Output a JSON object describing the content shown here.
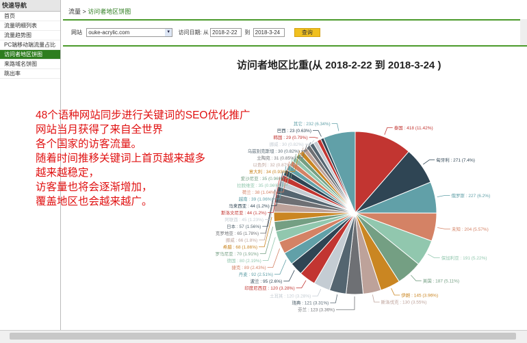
{
  "sidebar": {
    "title": "快速导航",
    "items": [
      "首页",
      "流量明细列表",
      "流量趋势图",
      "PC端移动端流量占比",
      "访问者地区饼图",
      "来路域名饼图",
      "跳出率"
    ],
    "active": 4
  },
  "breadcrumb": {
    "root": "流量",
    "sep": " > ",
    "current": "访问者地区饼图"
  },
  "filter": {
    "site_label": "网站",
    "site_value": "ouke-acrylic.com",
    "date_label": "访问日期: 从",
    "date_from": "2018-2-22",
    "to_label": "到",
    "date_to": "2018-3-24",
    "query_label": "查询"
  },
  "overlay_lines": [
    "48个语种网站同步进行关键词的SEO优化推广",
    "网站当月获得了来自全世界",
    "各个国家的访客流量。",
    "随着时间推移关键词上首页越来越多",
    "越来越稳定，",
    "访客量也将会逐渐增加，",
    "覆盖地区也会越来越广。"
  ],
  "chart_data": {
    "type": "pie",
    "title": "访问者地区比重(从 2018-2-22 到 2018-3-24 )",
    "slices": [
      {
        "label": "泰国",
        "value": 418,
        "pct": "11.42%",
        "color": "#c23531"
      },
      {
        "label": "匈牙利",
        "value": 271,
        "pct": "7.4%",
        "color": "#2f4554"
      },
      {
        "label": "俄罗斯",
        "value": 227,
        "pct": "6.2%",
        "color": "#61a0a8"
      },
      {
        "label": "未知",
        "value": 204,
        "pct": "5.57%",
        "color": "#d48265"
      },
      {
        "label": "保加利亚",
        "value": 191,
        "pct": "5.22%",
        "color": "#91c7ae"
      },
      {
        "label": "美国",
        "value": 187,
        "pct": "5.11%",
        "color": "#749f83"
      },
      {
        "label": "伊朗",
        "value": 145,
        "pct": "3.96%",
        "color": "#ca8622"
      },
      {
        "label": "斯洛伐克",
        "value": 130,
        "pct": "3.55%",
        "color": "#bda29a"
      },
      {
        "label": "芬兰",
        "value": 123,
        "pct": "3.36%",
        "color": "#6e7074"
      },
      {
        "label": "瑞典",
        "value": 121,
        "pct": "3.31%",
        "color": "#546570"
      },
      {
        "label": "土耳其",
        "value": 120,
        "pct": "3.28%",
        "color": "#c4ccd3"
      },
      {
        "label": "印度尼西亚",
        "value": 120,
        "pct": "3.28%",
        "color": "#c23531"
      },
      {
        "label": "波兰",
        "value": 95,
        "pct": "2.6%",
        "color": "#2f4554"
      },
      {
        "label": "丹麦",
        "value": 92,
        "pct": "2.51%",
        "color": "#61a0a8"
      },
      {
        "label": "捷克",
        "value": 89,
        "pct": "2.43%",
        "color": "#d48265"
      },
      {
        "label": "德国",
        "value": 80,
        "pct": "2.19%",
        "color": "#91c7ae"
      },
      {
        "label": "罗马尼亚",
        "value": 70,
        "pct": "1.91%",
        "color": "#749f83"
      },
      {
        "label": "希腊",
        "value": 68,
        "pct": "1.86%",
        "color": "#ca8622"
      },
      {
        "label": "挪威",
        "value": 66,
        "pct": "1.8%",
        "color": "#bda29a"
      },
      {
        "label": "克罗地亚",
        "value": 65,
        "pct": "1.78%",
        "color": "#6e7074"
      },
      {
        "label": "日本",
        "value": 57,
        "pct": "1.56%",
        "color": "#546570"
      },
      {
        "label": "阿联酋",
        "value": 45,
        "pct": "1.23%",
        "color": "#c4ccd3"
      },
      {
        "label": "斯洛文尼亚",
        "value": 44,
        "pct": "1.2%",
        "color": "#c23531"
      },
      {
        "label": "马来西亚",
        "value": 44,
        "pct": "1.2%",
        "color": "#2f4554"
      },
      {
        "label": "越南",
        "value": 39,
        "pct": "1.06%",
        "color": "#61a0a8"
      },
      {
        "label": "荷兰",
        "value": 38,
        "pct": "1.04%",
        "color": "#d48265"
      },
      {
        "label": "拉脱维亚",
        "value": 35,
        "pct": "0.96%",
        "color": "#91c7ae"
      },
      {
        "label": "爱沙尼亚",
        "value": 35,
        "pct": "0.96%",
        "color": "#749f83"
      },
      {
        "label": "意大利",
        "value": 34,
        "pct": "0.93%",
        "color": "#ca8622"
      },
      {
        "label": "以色列",
        "value": 32,
        "pct": "0.87%",
        "color": "#bda29a"
      },
      {
        "label": "立陶宛",
        "value": 31,
        "pct": "0.85%",
        "color": "#6e7074"
      },
      {
        "label": "乌兹别克斯坦",
        "value": 30,
        "pct": "0.82%",
        "color": "#546570"
      },
      {
        "label": "挪威",
        "value": 30,
        "pct": "0.82%",
        "color": "#c4ccd3"
      },
      {
        "label": "韩国",
        "value": 29,
        "pct": "0.79%",
        "color": "#c23531"
      },
      {
        "label": "巴西",
        "value": 23,
        "pct": "0.63%",
        "color": "#2f4554"
      },
      {
        "label": "其它",
        "value": 232,
        "pct": "6.34%",
        "color": "#61a0a8"
      }
    ]
  }
}
